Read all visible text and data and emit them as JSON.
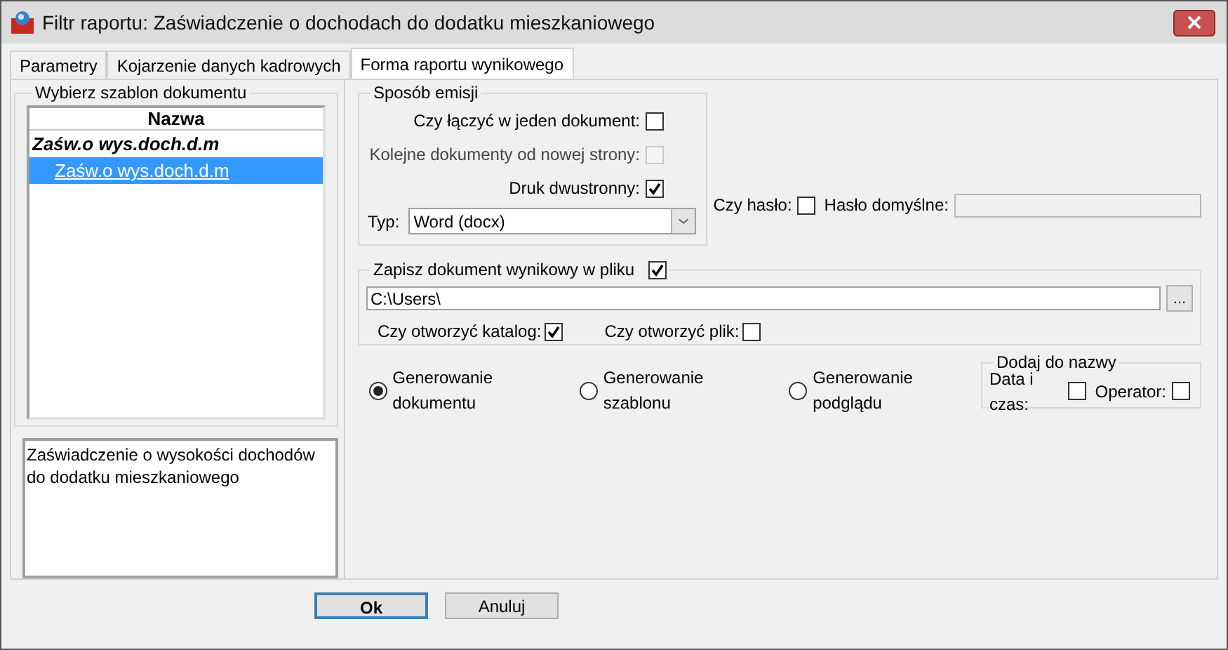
{
  "window": {
    "title": "Filtr raportu: Zaświadczenie o dochodach do dodatku mieszkaniowego"
  },
  "tabs": [
    {
      "label": "Parametry",
      "selected": false
    },
    {
      "label": "Kojarzenie danych kadrowych",
      "selected": false
    },
    {
      "label": "Forma raportu wynikowego",
      "selected": true
    }
  ],
  "template_panel": {
    "title": "Wybierz szablon dokumentu",
    "column": "Nazwa",
    "items": [
      {
        "label": "Zaśw.o wys.doch.d.m",
        "kind": "group",
        "selected": false
      },
      {
        "label": "Zaśw.o wys.doch.d.m",
        "kind": "item",
        "selected": true
      }
    ],
    "description": "Zaświadczenie o wysokości dochodów do dodatku mieszkaniowego"
  },
  "emission": {
    "title": "Sposób emisji",
    "options": [
      {
        "label": "Czy łączyć w jeden dokument:",
        "checked": false,
        "disabled": false
      },
      {
        "label": "Kolejne dokumenty od nowej strony:",
        "checked": false,
        "disabled": true
      },
      {
        "label": "Druk dwustronny:",
        "checked": true,
        "disabled": false
      }
    ],
    "type_label": "Typ:",
    "type_value": "Word (docx)"
  },
  "password": {
    "label": "Czy hasło:",
    "checked": false,
    "default_label": "Hasło domyślne:"
  },
  "save_file": {
    "title": "Zapisz dokument wynikowy w pliku",
    "checked": true,
    "path": "C:\\Users\\",
    "browse": "...",
    "options": [
      {
        "label": "Czy otworzyć katalog:",
        "checked": true
      },
      {
        "label": "Czy otworzyć plik:",
        "checked": false
      }
    ]
  },
  "generation": [
    {
      "label": "Generowanie dokumentu",
      "selected": true
    },
    {
      "label": "Generowanie szablonu",
      "selected": false
    },
    {
      "label": "Generowanie podglądu",
      "selected": false
    }
  ],
  "name_suffix": {
    "title": "Dodaj do nazwy",
    "options": [
      {
        "label": "Data i czas:",
        "checked": false
      },
      {
        "label": "Operator:",
        "checked": false
      }
    ]
  },
  "buttons": [
    {
      "label": "Ok",
      "default": true
    },
    {
      "label": "Anuluj",
      "default": false
    }
  ]
}
